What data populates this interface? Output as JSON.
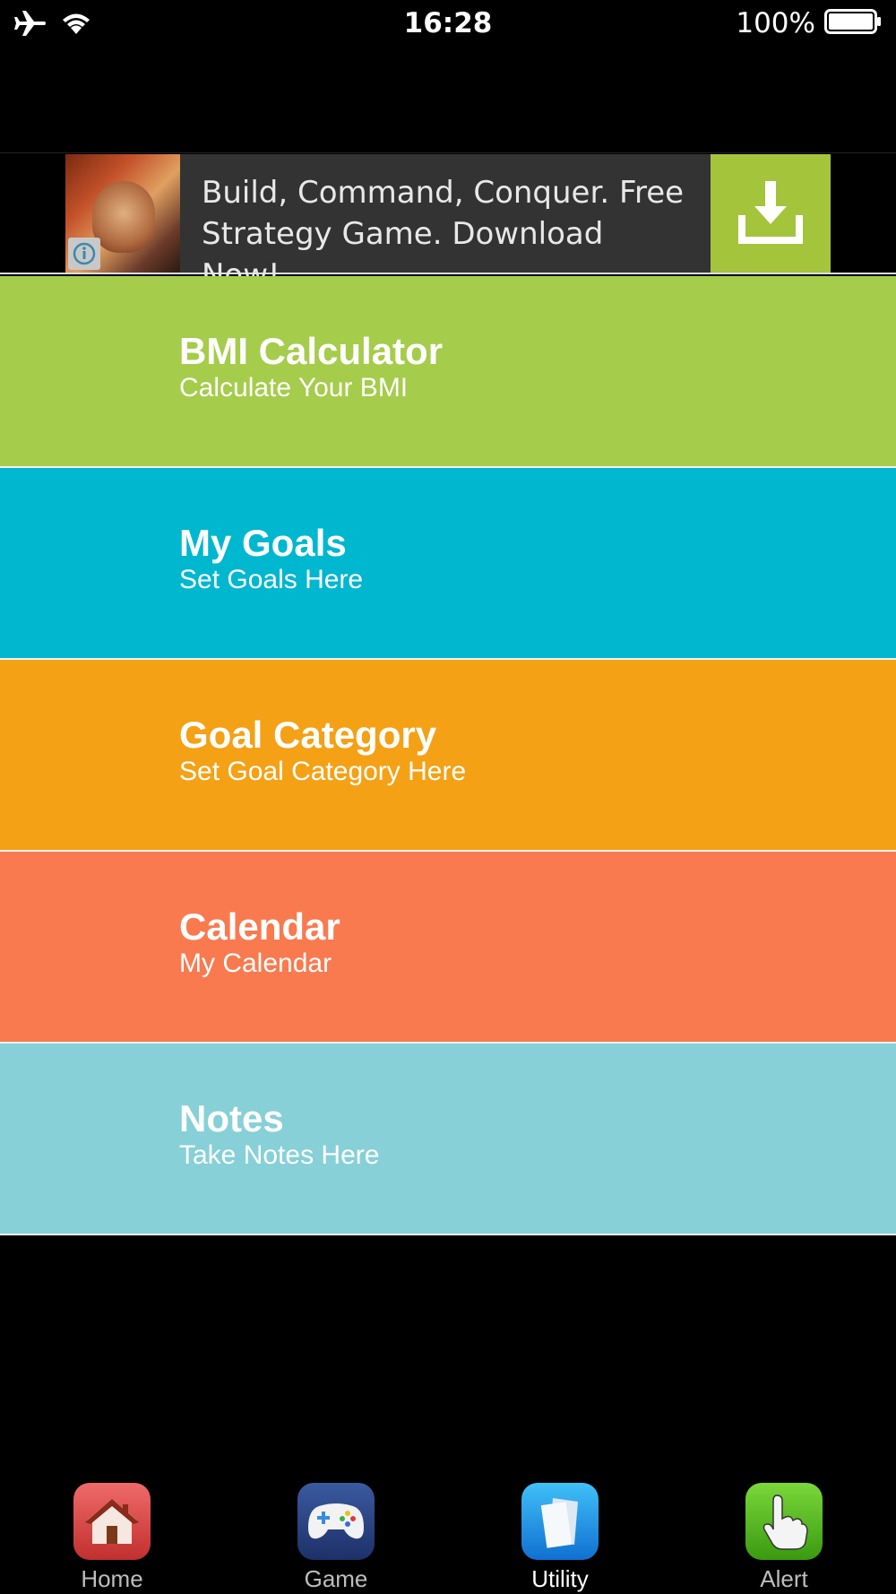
{
  "status_bar": {
    "time": "16:28",
    "battery": "100%",
    "icons": [
      "airplane-icon",
      "wifi-icon",
      "battery-icon"
    ]
  },
  "ad": {
    "text": "Build, Command, Conquer. Free Strategy Game. Download Now!",
    "download_icon": "download-icon",
    "colors": {
      "background": "#333333",
      "button": "#a4c43c"
    }
  },
  "menu": [
    {
      "title": "BMI Calculator",
      "subtitle": "Calculate Your BMI",
      "color": "#a5cc4b"
    },
    {
      "title": "My Goals",
      "subtitle": "Set Goals Here",
      "color": "#00b7d0"
    },
    {
      "title": "Goal Category",
      "subtitle": "Set Goal Category Here",
      "color": "#f5a115"
    },
    {
      "title": "Calendar",
      "subtitle": "My Calendar",
      "color": "#f97a4f"
    },
    {
      "title": "Notes",
      "subtitle": "Take Notes Here",
      "color": "#87d0d7"
    }
  ],
  "tabs": [
    {
      "label": "Home",
      "icon": "house-icon",
      "color": "#e04a4a",
      "active": false
    },
    {
      "label": "Game",
      "icon": "gamepad-icon",
      "color": "#2e4a8a",
      "active": false
    },
    {
      "label": "Utility",
      "icon": "documents-icon",
      "color": "#1ea0e8",
      "active": true
    },
    {
      "label": "Alert",
      "icon": "hand-pointer-icon",
      "color": "#5cb81c",
      "active": false
    }
  ]
}
